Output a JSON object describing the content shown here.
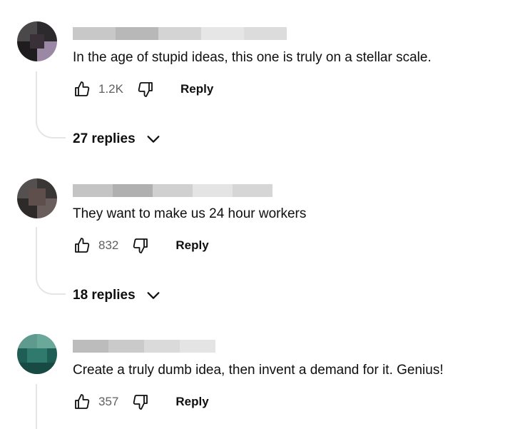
{
  "comments": [
    {
      "text": "In the age of stupid ideas, this one is truly on a stellar scale.",
      "likes": "1.2K",
      "reply_label": "Reply",
      "replies_label": "27 replies",
      "avatar_colors": [
        "#2a2a2a",
        "#5a4a5a",
        "#9a8aa0",
        "#1e1a20"
      ]
    },
    {
      "text": "They want to make us 24 hour workers",
      "likes": "832",
      "reply_label": "Reply",
      "replies_label": "18 replies",
      "avatar_colors": [
        "#3c3c3c",
        "#5e5250",
        "#2a2426",
        "#7a6a66"
      ]
    },
    {
      "text": "Create a truly dumb idea, then invent a demand for it. Genius!",
      "likes": "357",
      "reply_label": "Reply",
      "avatar_colors": [
        "#1f5e54",
        "#2f7a6c",
        "#174a42",
        "#5f9a8e"
      ]
    }
  ],
  "icons": {
    "like": "thumb-up-icon",
    "dislike": "thumb-down-icon",
    "expand": "chevron-down-icon"
  }
}
